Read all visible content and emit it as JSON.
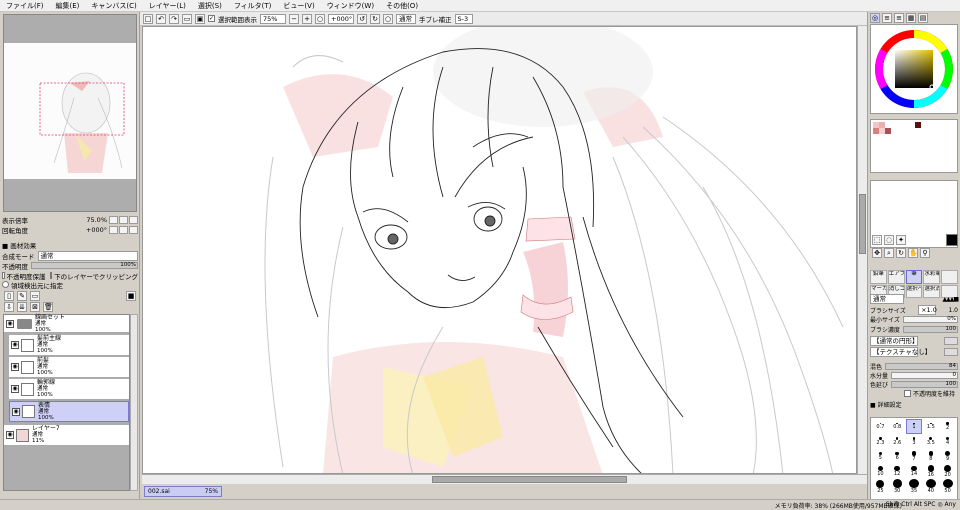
{
  "menu": [
    "ファイル(F)",
    "編集(E)",
    "キャンバス(C)",
    "レイヤー(L)",
    "選択(S)",
    "フィルタ(T)",
    "ビュー(V)",
    "ウィンドウ(W)",
    "その他(O)"
  ],
  "toolbar": {
    "selection_display_label": "選択範囲表示",
    "zoom": "75%",
    "rotation": "+000°",
    "mode": "通常",
    "stabilizer_label": "手ブレ補正",
    "stabilizer_value": "S-3"
  },
  "navigator": {
    "zoom_label": "表示倍率",
    "zoom_value": "75.0%",
    "angle_label": "回転角度",
    "angle_value": "+000°"
  },
  "layer_props": {
    "effect_title": "■ 画材効果",
    "blend_mode_label": "合成モード",
    "blend_mode_value": "通常",
    "opacity_label": "不透明度",
    "opacity_value": "100%",
    "protect_opacity_label": "不透明度保護",
    "clip_label": "下のレイヤーでクリッピング",
    "selection_source_label": "領域検出元に指定"
  },
  "layers": [
    {
      "name": "線画セット",
      "mode": "通常",
      "opacity": "100%",
      "type": "folder",
      "selected": false
    },
    {
      "name": "髪前主線",
      "mode": "通常",
      "opacity": "100%",
      "type": "layer",
      "selected": false
    },
    {
      "name": "前髪",
      "mode": "通常",
      "opacity": "100%",
      "type": "layer",
      "selected": false
    },
    {
      "name": "輪郭線",
      "mode": "通常",
      "opacity": "100%",
      "type": "layer",
      "selected": false
    },
    {
      "name": "表情",
      "mode": "通常",
      "opacity": "100%",
      "type": "layer",
      "selected": true
    },
    {
      "name": "レイヤー7",
      "mode": "通常",
      "opacity": "11%",
      "type": "image",
      "selected": false
    }
  ],
  "document_tab": {
    "name": "002.sai",
    "zoom": "75%"
  },
  "status": {
    "memory": "メモリ負荷率: 38% (266MB使用/957MB確保)",
    "keys": "Shift Ctrl Alt SPC ◎ Any"
  },
  "tools_row1": [
    "鉛筆",
    "エアブラシ",
    "筆",
    "水彩筆",
    ""
  ],
  "tools_row2": [
    "マーカー",
    "消しゴム",
    "選択ペン",
    "選択消し",
    ""
  ],
  "brush": {
    "mode_value": "通常",
    "size_label": "ブラシサイズ",
    "size_mult": "×1.0",
    "size_value": "1.0",
    "min_size_label": "最小サイズ",
    "min_size_value": "0%",
    "density_label": "ブラシ濃度",
    "density_value": "100",
    "shape_value": "【通常の円形】",
    "texture_value": "【テクスチャなし】",
    "blend_label": "混色",
    "blend_value": "84",
    "water_label": "水分量",
    "water_value": "0",
    "persistence_label": "色延び",
    "persistence_value": "100",
    "keep_opacity_label": "不透明度を維持",
    "detail_label": "■ 詳細設定"
  },
  "brush_sizes": [
    "0.7",
    "0.8",
    "1",
    "1.5",
    "2",
    "2.3",
    "2.6",
    "3",
    "3.5",
    "4",
    "5",
    "6",
    "7",
    "8",
    "9",
    "10",
    "12",
    "14",
    "16",
    "20",
    "25",
    "30",
    "35",
    "40",
    "50"
  ],
  "colors": {
    "accent": "#7b7fc8",
    "selected_fill": "#cfd0f8",
    "current_color": "#000000"
  }
}
